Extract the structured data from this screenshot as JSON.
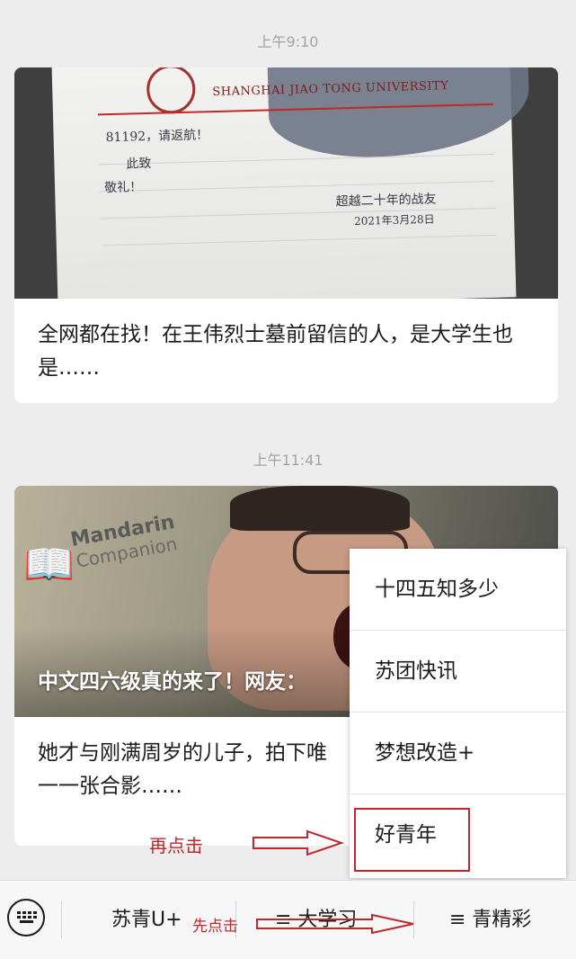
{
  "feed": {
    "time_1": "上午9:10",
    "card_1": {
      "title": "全网都在找！在王伟烈士墓前留信的人，是大学生也是……",
      "image": {
        "university_name": "SHANGHAI JIAO TONG UNIVERSITY",
        "handwriting": [
          "81192，请返航！",
          "此致",
          "敬礼！",
          "超越二十年的战友",
          "2021年3月28日"
        ]
      }
    },
    "time_2": "上午11:41",
    "card_2": {
      "overlay_title": "中文四六级真的来了！网友：",
      "image": {
        "logo_line_1": "Mandarin",
        "logo_line_2": "Companion"
      },
      "summary": "她才与刚满周岁的儿子，拍下唯一一张合影……"
    }
  },
  "submenu": {
    "items": [
      "十四五知多少",
      "苏团快讯",
      "梦想改造+",
      "好青年"
    ]
  },
  "annotations": {
    "click_again": "再点击",
    "click_first": "先点击"
  },
  "bottom_menu": {
    "keyboard_icon": "keyboard-icon",
    "tab_1": "苏青U+",
    "tab_2": "≡ 大学习",
    "tab_3": "≡ 青精彩"
  },
  "colors": {
    "annotation_red": "#c0272d",
    "background": "#ededed"
  }
}
